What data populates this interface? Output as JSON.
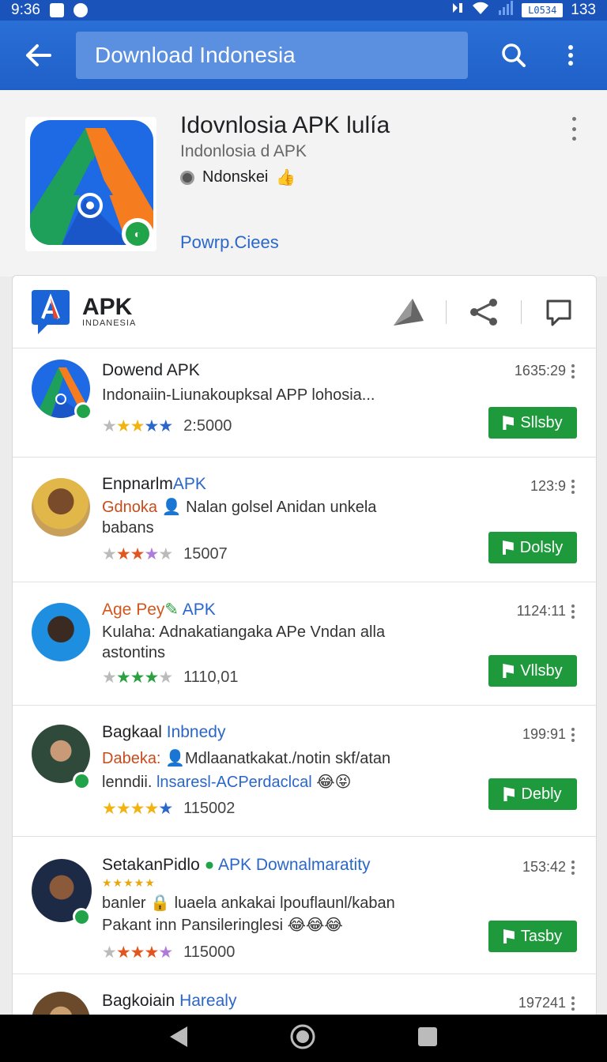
{
  "status_bar": {
    "time": "9:36",
    "battery_text": "L0534",
    "battery_level": "133"
  },
  "app_bar": {
    "search_text": "Download Indonesia"
  },
  "app_header": {
    "title": "Idovnlosia APK lulía",
    "subtitle": "Indonlosia d APK",
    "developer": "Ndonskei",
    "powered": "Powrp.Ciees"
  },
  "brand": {
    "name": "APK",
    "tagline": "INDANESIA"
  },
  "items": [
    {
      "title": "Dowend APK",
      "desc": "Indonaiin-Liunakoupksal APP lohosia...",
      "time": "1635:29",
      "rating": "2:5000",
      "button": "Sllsby"
    },
    {
      "title_a": "Enpnarlm",
      "title_b": "APK",
      "desc_a": "Gdnoka",
      "desc_b": "Nalan golsel Anidan unkela babans",
      "time": "123:9",
      "rating": "15007",
      "button": "Dolsly"
    },
    {
      "title_a": "Age Pey",
      "title_b": "APK",
      "desc": "Kulaha: Adnakatiangaka APe Vndan alla astontins",
      "time": "1124:11",
      "rating": "1110,01",
      "button": "Vllsby"
    },
    {
      "title_a": "Bagkaal",
      "title_b": "Inbnedy",
      "desc_a": "Dabeka:",
      "desc_b": "Mdlaanatkakat./notin skf/atan",
      "desc_c": "lenndii.",
      "desc_d": "lnsaresl-ACPerdaclcal",
      "time": "199:91",
      "rating": "115002",
      "button": "Debly"
    },
    {
      "title_a": "SetakanPidlo",
      "title_b": "APK Downalmaratity",
      "desc_a": "banler",
      "desc_b": "luaela ankakai lpouflaunl/kaban",
      "desc_c": "Pakant inn Pansileringlesi",
      "time": "153:42",
      "rating": "115000",
      "button": "Tasby"
    },
    {
      "title_a": "Bagkoiain",
      "title_b": "Harealy",
      "time": "197241"
    }
  ]
}
